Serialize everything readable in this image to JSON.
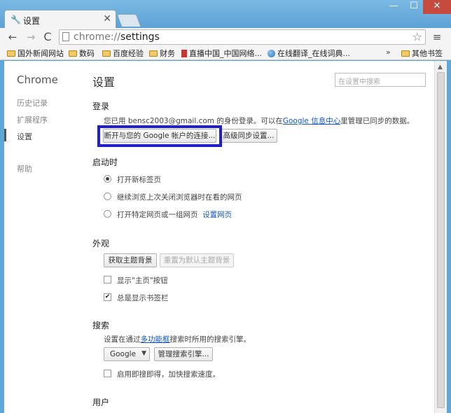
{
  "window": {
    "tab_title": "设置",
    "tab_close": "✕",
    "min": "—",
    "max": "☐",
    "close": "✕"
  },
  "toolbar": {
    "back": "←",
    "forward": "→",
    "reload": "C",
    "url_scheme": "chrome://",
    "url_path": "settings",
    "star": "☆",
    "menu": "≡"
  },
  "bookmarks": {
    "items": [
      "国外新闻网站",
      "数码",
      "百度经验",
      "财务",
      "直播中国_中国网络...",
      "在线翻译_在线词典..."
    ],
    "more": "»",
    "other": "其他书签"
  },
  "sidebar": {
    "title": "Chrome",
    "items": [
      "历史记录",
      "扩展程序",
      "设置",
      "帮助"
    ]
  },
  "main": {
    "title": "设置",
    "search_placeholder": "在设置中搜索"
  },
  "signin": {
    "heading": "登录",
    "text_prefix": "您已用 bensc2003@gmail.com 的身份登录。可以在",
    "text_link": "Google 信息中心",
    "text_suffix": "里管理已同步的数据。",
    "disconnect_button": "断开与您的 Google 帐户的连接...",
    "advanced_sync_button": "高级同步设置..."
  },
  "startup": {
    "heading": "启动时",
    "options": [
      "打开新标签页",
      "继续浏览上次关闭浏览器时在看的网页",
      "打开特定网页或一组网页"
    ],
    "set_pages_link": "设置网页",
    "selected_index": 0
  },
  "appearance": {
    "heading": "外观",
    "get_themes_button": "获取主题背景",
    "reset_theme_button": "重置为默认主题背景",
    "show_home_label": "显示\"主页\"按钮",
    "show_home_checked": false,
    "show_bookmarks_label": "总是显示书签栏",
    "show_bookmarks_checked": true
  },
  "search": {
    "heading": "搜索",
    "text_prefix": "设置在通过",
    "text_link": "多功能框",
    "text_suffix": "搜索时所用的搜索引擎。",
    "engine": "Google",
    "manage_button": "管理搜索引擎...",
    "instant_label": "启用即搜即得，加快搜索速度。",
    "instant_checked": false
  },
  "users": {
    "heading": "用户"
  }
}
